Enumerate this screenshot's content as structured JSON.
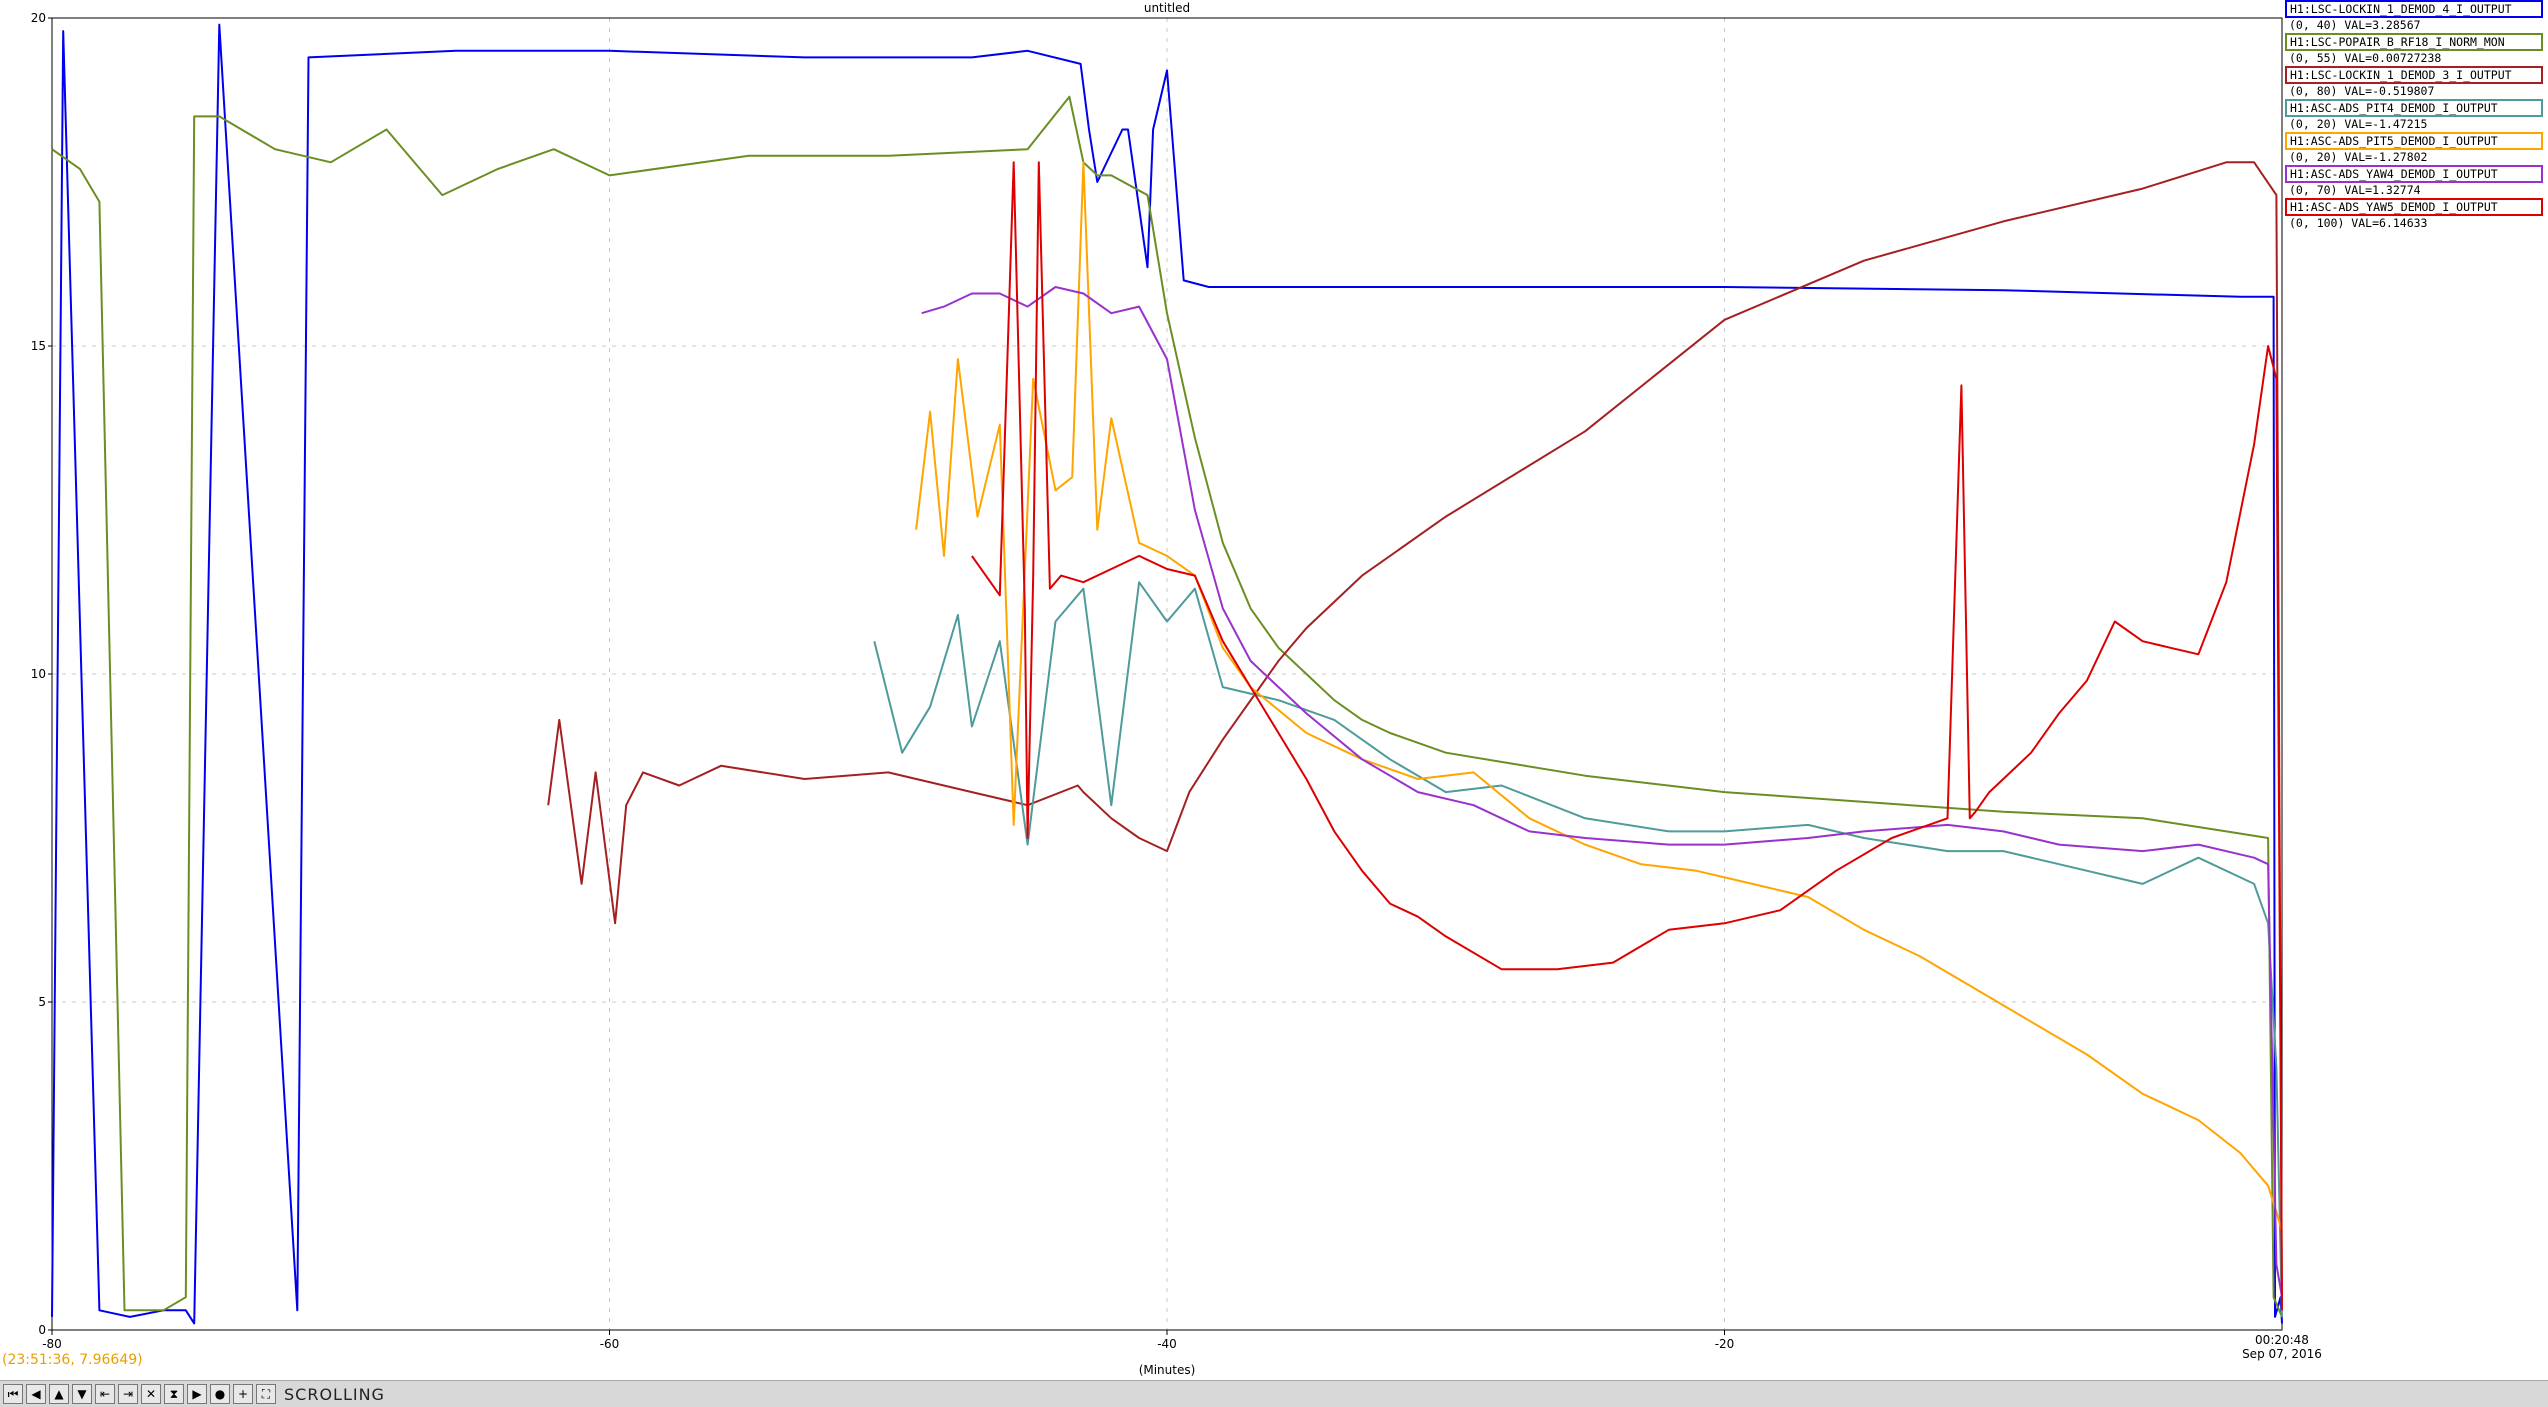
{
  "chart_data": {
    "type": "line",
    "title": "untitled",
    "xlabel": "(Minutes)",
    "ylabel": "",
    "xlim": [
      -80,
      0
    ],
    "ylim": [
      0,
      20
    ],
    "x_ticks": [
      "-80",
      "-60",
      "-40",
      "-20"
    ],
    "x_end_label": [
      "00:20:48",
      "Sep 07, 2016"
    ],
    "y_ticks": [
      "0",
      "5",
      "10",
      "15",
      "20"
    ],
    "grid": true,
    "legend_position": "top-right",
    "series": [
      {
        "name": "H1:LSC-LOCKIN_1_DEMOD_4_I_OUTPUT",
        "range_val": "(0, 40)  VAL=3.28567",
        "color": "#0000ee",
        "x": [
          -80,
          -79.6,
          -78.3,
          -77.2,
          -76.0,
          -75.2,
          -74.9,
          -74.0,
          -71.2,
          -70.8,
          -65.5,
          -60,
          -53,
          -47,
          -45,
          -43.1,
          -42.8,
          -42.5,
          -41.6,
          -41.4,
          -40.7,
          -40.5,
          -40.0,
          -39.4,
          -38.5,
          -35,
          -30,
          -20,
          -10,
          -1.5,
          -0.3,
          -0.25,
          -0.05,
          0
        ],
        "y": [
          0.2,
          19.8,
          0.3,
          0.2,
          0.3,
          0.3,
          0.1,
          19.9,
          0.3,
          19.4,
          19.5,
          19.5,
          19.4,
          19.4,
          19.5,
          19.3,
          18.3,
          17.5,
          18.3,
          18.3,
          16.2,
          18.3,
          19.2,
          16.0,
          15.9,
          15.9,
          15.9,
          15.9,
          15.85,
          15.75,
          15.75,
          0.2,
          0.5,
          0.1
        ]
      },
      {
        "name": "H1:LSC-POPAIR_B_RF18_I_NORM_MON",
        "range_val": "(0, 55)  VAL=0.00727238",
        "color": "#6b8e23",
        "x": [
          -80,
          -79,
          -78.3,
          -77.4,
          -76,
          -75.2,
          -74.9,
          -74,
          -72,
          -70,
          -68,
          -66,
          -64,
          -62,
          -60,
          -55,
          -50,
          -45,
          -43.5,
          -43,
          -42.5,
          -42,
          -40.7,
          -40,
          -39,
          -38,
          -37,
          -36,
          -35,
          -34,
          -33,
          -32,
          -30,
          -25,
          -20,
          -15,
          -10,
          -5,
          -2,
          -0.5,
          -0.3,
          -0.1,
          0
        ],
        "y": [
          18.0,
          17.7,
          17.2,
          0.3,
          0.3,
          0.5,
          18.5,
          18.5,
          18.0,
          17.8,
          18.3,
          17.3,
          17.7,
          18.0,
          17.6,
          17.9,
          17.9,
          18.0,
          18.8,
          17.8,
          17.6,
          17.6,
          17.3,
          15.5,
          13.6,
          12.0,
          11.0,
          10.4,
          10.0,
          9.6,
          9.3,
          9.1,
          8.8,
          8.45,
          8.2,
          8.05,
          7.9,
          7.8,
          7.6,
          7.5,
          0.5,
          0.3,
          0.2
        ]
      },
      {
        "name": "H1:LSC-LOCKIN_1_DEMOD_3_I_OUTPUT",
        "range_val": "(0, 80)  VAL=-0.519807",
        "color": "#a52020",
        "x": [
          -62.2,
          -61.8,
          -61.0,
          -60.5,
          -59.8,
          -59.4,
          -58.8,
          -57.5,
          -56,
          -53,
          -50,
          -47,
          -45,
          -43.2,
          -43,
          -42,
          -41,
          -40,
          -39.2,
          -38,
          -36,
          -35,
          -33,
          -30,
          -25,
          -20,
          -15,
          -10,
          -5,
          -2,
          -1.0,
          -0.2,
          0
        ],
        "y": [
          8.0,
          9.3,
          6.8,
          8.5,
          6.2,
          8.0,
          8.5,
          8.3,
          8.6,
          8.4,
          8.5,
          8.2,
          8.0,
          8.3,
          8.2,
          7.8,
          7.5,
          7.3,
          8.2,
          9.0,
          10.2,
          10.7,
          11.5,
          12.4,
          13.7,
          15.4,
          16.3,
          16.9,
          17.4,
          17.8,
          17.8,
          17.3,
          0.3
        ]
      },
      {
        "name": "H1:ASC-ADS_PIT4_DEMOD_I_OUTPUT",
        "range_val": "(0, 20)  VAL=-1.47215",
        "color": "#4f9a9a",
        "x": [
          -50.5,
          -49.5,
          -48.5,
          -47.5,
          -47,
          -46,
          -45,
          -44,
          -43,
          -42,
          -41,
          -40,
          -39,
          -38,
          -36,
          -34,
          -32,
          -30,
          -28,
          -25,
          -22,
          -20,
          -17,
          -15,
          -12,
          -10,
          -8,
          -5,
          -3,
          -1,
          -0.5,
          -0.2,
          0
        ],
        "y": [
          10.5,
          8.8,
          9.5,
          10.9,
          9.2,
          10.5,
          7.4,
          10.8,
          11.3,
          8.0,
          11.4,
          10.8,
          11.3,
          9.8,
          9.6,
          9.3,
          8.7,
          8.2,
          8.3,
          7.8,
          7.6,
          7.6,
          7.7,
          7.5,
          7.3,
          7.3,
          7.1,
          6.8,
          7.2,
          6.8,
          6.2,
          4.0,
          0.2
        ]
      },
      {
        "name": "H1:ASC-ADS_PIT5_DEMOD_I_OUTPUT",
        "range_val": "(0, 20)  VAL=-1.27802",
        "color": "#ffa500",
        "x": [
          -49,
          -48.5,
          -48,
          -47.5,
          -46.8,
          -46,
          -45.5,
          -44.8,
          -44,
          -43.4,
          -43,
          -42.5,
          -42,
          -41,
          -40,
          -39,
          -38,
          -37,
          -35,
          -33,
          -31,
          -29,
          -27,
          -25,
          -23,
          -21,
          -19,
          -17,
          -15,
          -13,
          -11,
          -9,
          -7,
          -5,
          -3,
          -1.5,
          -0.5,
          -0.2,
          0
        ],
        "y": [
          12.2,
          14.0,
          11.8,
          14.8,
          12.4,
          13.8,
          7.7,
          14.5,
          12.8,
          13.0,
          17.8,
          12.2,
          13.9,
          12.0,
          11.8,
          11.5,
          10.4,
          9.8,
          9.1,
          8.7,
          8.4,
          8.5,
          7.8,
          7.4,
          7.1,
          7.0,
          6.8,
          6.6,
          6.1,
          5.7,
          5.2,
          4.7,
          4.2,
          3.6,
          3.2,
          2.7,
          2.2,
          1.8,
          1.5
        ]
      },
      {
        "name": "H1:ASC-ADS_YAW4_DEMOD_I_OUTPUT",
        "range_val": "(0, 70)  VAL=1.32774",
        "color": "#9932cc",
        "x": [
          -48.8,
          -48,
          -47,
          -46,
          -45,
          -44,
          -43,
          -42,
          -41,
          -40,
          -39,
          -38,
          -37,
          -35,
          -33,
          -31,
          -29,
          -27,
          -25,
          -22,
          -20,
          -17,
          -15,
          -12,
          -10,
          -8,
          -5,
          -3,
          -1,
          -0.5,
          -0.2,
          0
        ],
        "y": [
          15.5,
          15.6,
          15.8,
          15.8,
          15.6,
          15.9,
          15.8,
          15.5,
          15.6,
          14.8,
          12.5,
          11.0,
          10.2,
          9.4,
          8.7,
          8.2,
          8.0,
          7.6,
          7.5,
          7.4,
          7.4,
          7.5,
          7.6,
          7.7,
          7.6,
          7.4,
          7.3,
          7.4,
          7.2,
          7.1,
          1.0,
          0.5
        ]
      },
      {
        "name": "H1:ASC-ADS_YAW5_DEMOD_I_OUTPUT",
        "range_val": "(0, 100)  VAL=6.14633",
        "color": "#dd0000",
        "x": [
          -47,
          -46,
          -45.5,
          -45.1,
          -45,
          -44.8,
          -44.6,
          -44.2,
          -43.8,
          -43,
          -42,
          -41,
          -40,
          -39,
          -38,
          -37,
          -36,
          -35,
          -34,
          -33,
          -32,
          -31,
          -30,
          -28,
          -26,
          -24,
          -22,
          -20,
          -18,
          -16,
          -14,
          -12,
          -11.5,
          -11.2,
          -11.0,
          -10.5,
          -10,
          -9,
          -8,
          -7,
          -6,
          -5,
          -4,
          -3,
          -2,
          -1,
          -0.5,
          -0.2,
          0
        ],
        "y": [
          11.8,
          11.2,
          17.8,
          11.0,
          7.5,
          11.5,
          17.8,
          11.3,
          11.5,
          11.4,
          11.6,
          11.8,
          11.6,
          11.5,
          10.5,
          9.8,
          9.1,
          8.4,
          7.6,
          7.0,
          6.5,
          6.3,
          6.0,
          5.5,
          5.5,
          5.6,
          6.1,
          6.2,
          6.4,
          7.0,
          7.5,
          7.8,
          14.4,
          7.8,
          7.9,
          8.2,
          8.4,
          8.8,
          9.4,
          9.9,
          10.8,
          10.5,
          10.4,
          10.3,
          11.4,
          13.5,
          15.0,
          14.5,
          0.3
        ]
      }
    ]
  },
  "status": {
    "cursor_readout": "(23:51:36, 7.96649)",
    "mode_label": "SCROLLING"
  },
  "toolbar_icons": [
    "skip-back-icon",
    "step-back-icon",
    "up-icon",
    "down-icon",
    "start-icon",
    "end-icon",
    "zoom-x-icon",
    "hourglass-icon",
    "pause-icon",
    "circle-icon",
    "add-icon",
    "zoom-fit-icon"
  ]
}
